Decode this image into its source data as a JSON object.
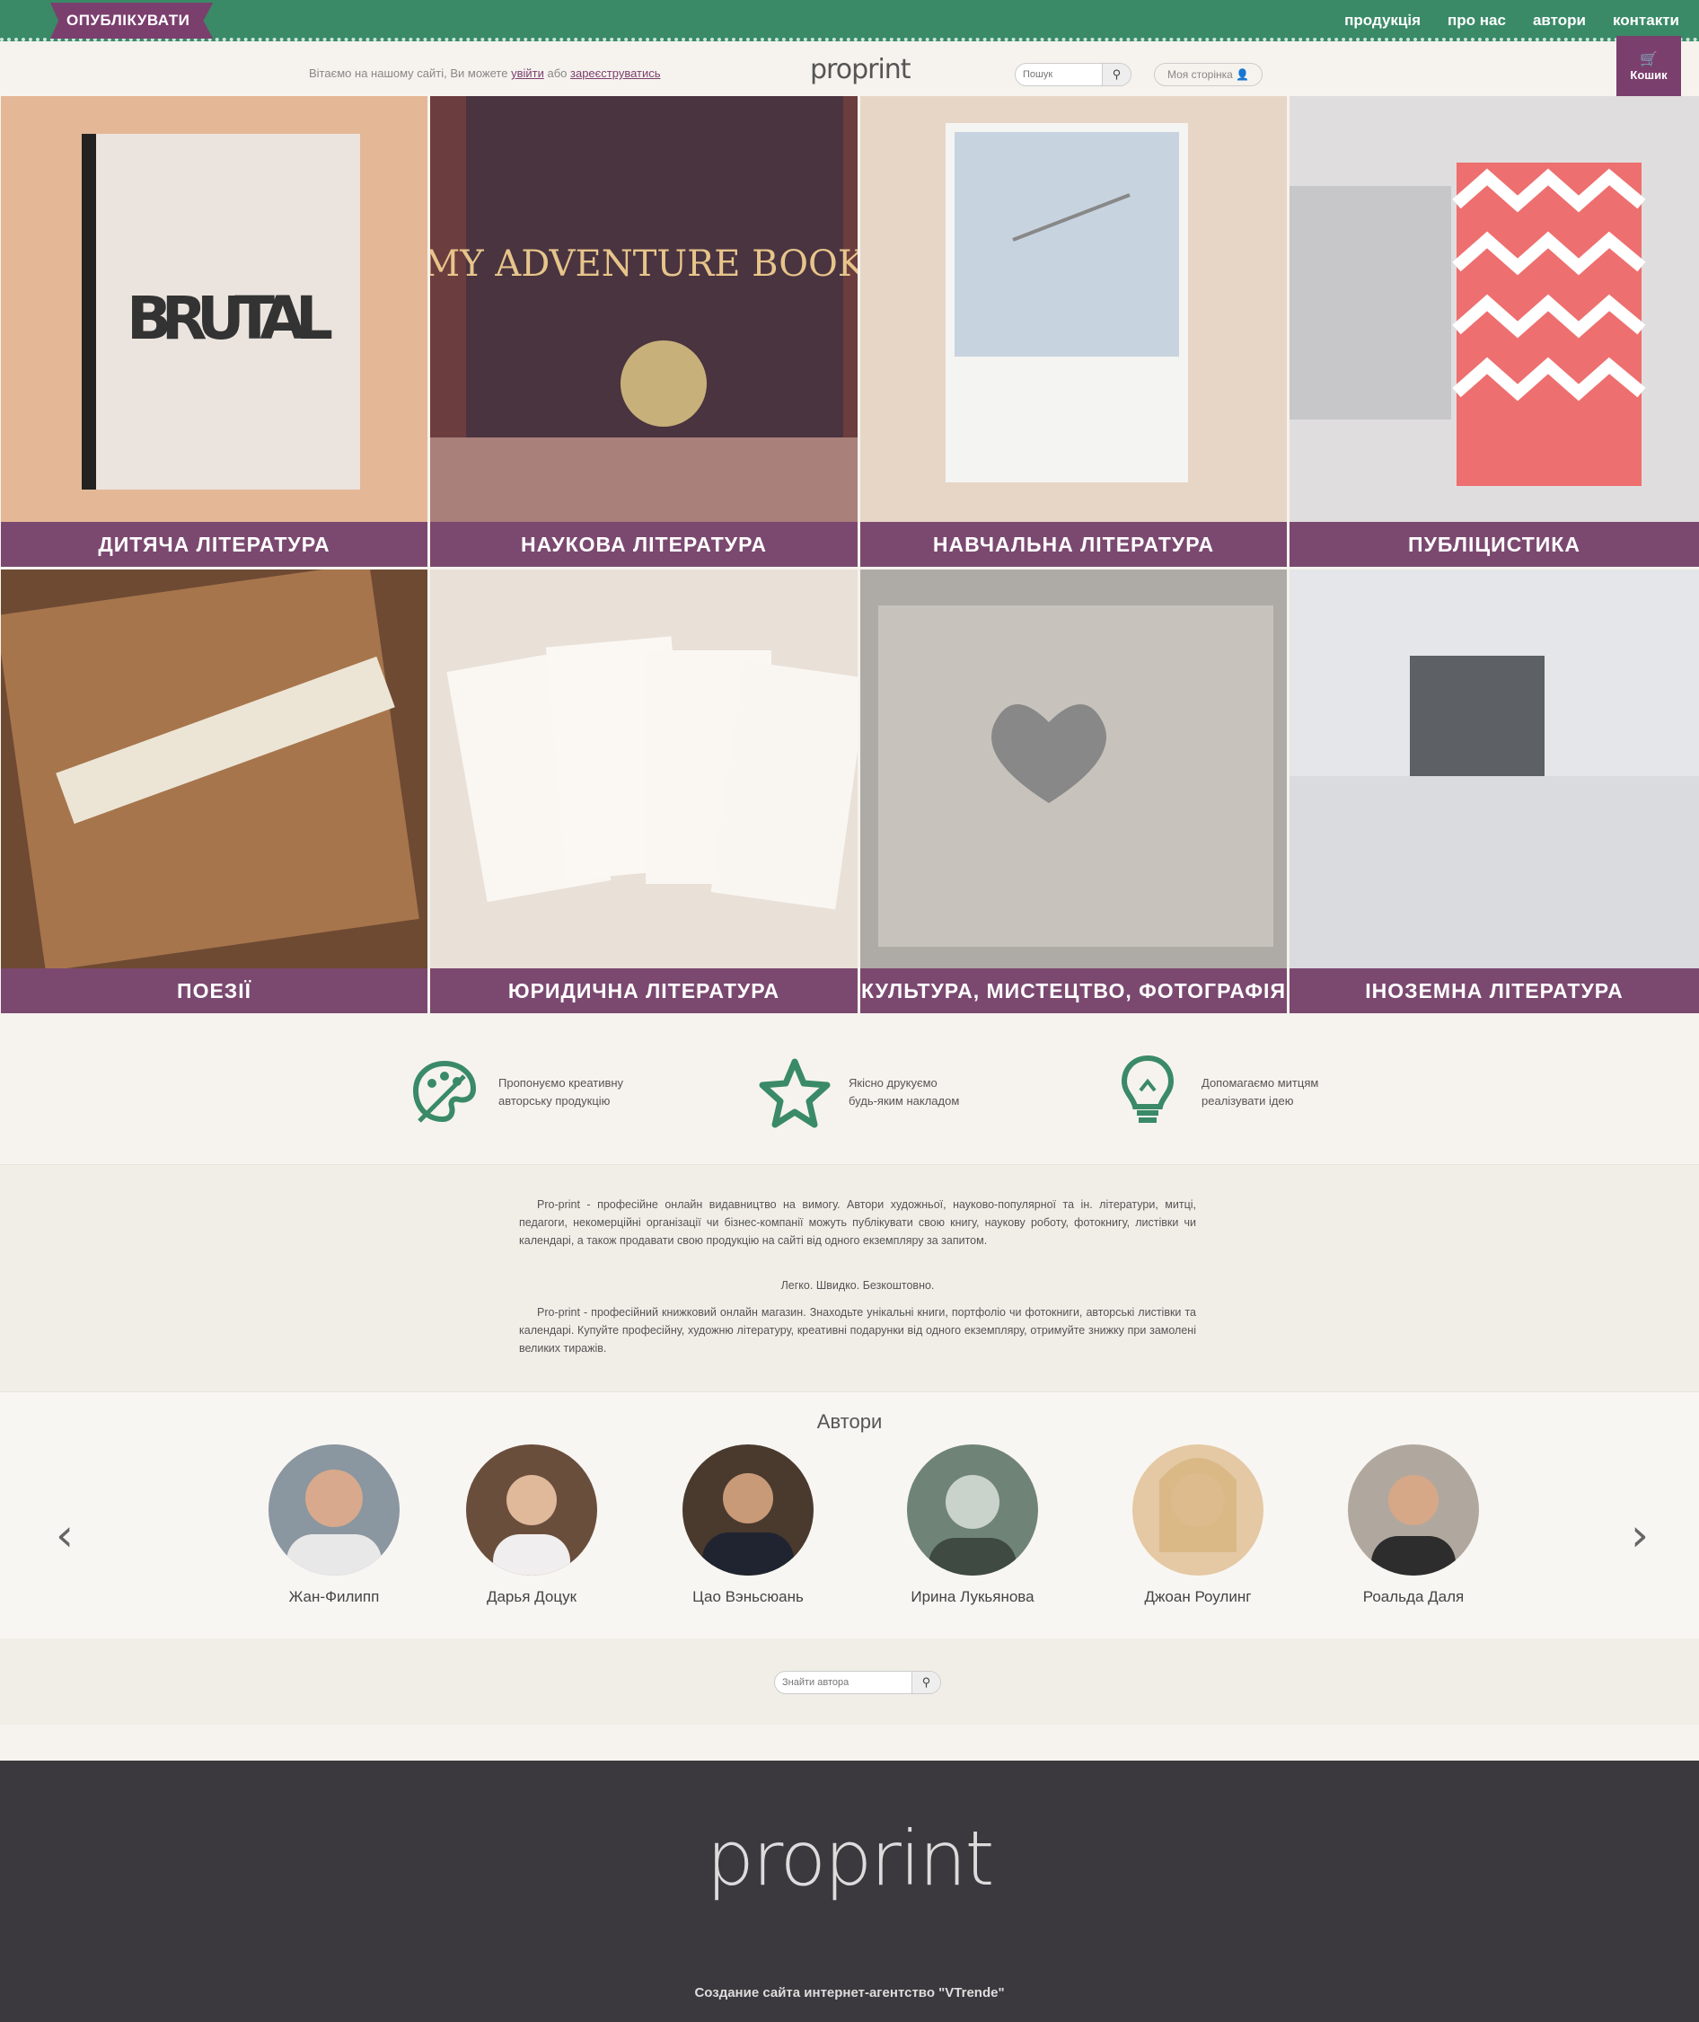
{
  "topbar": {
    "publish_label": "ОПУБЛІКУВАТИ",
    "nav": [
      "продукція",
      "про нас",
      "автори",
      "контакти"
    ],
    "cart_label": "Кошик"
  },
  "header": {
    "welcome_prefix": "Вітаємо на нашому сайті, Ви можете",
    "login": "увійти",
    "or": "або",
    "register": "зареєструватись",
    "logo": "proprint",
    "search_placeholder": "Пошук",
    "my_page": "Моя сторінка"
  },
  "categories": [
    "ДИТЯЧА ЛІТЕРАТУРА",
    "НАУКОВА ЛІТЕРАТУРА",
    "НАВЧАЛЬНА ЛІТЕРАТУРА",
    "ПУБЛІЦИСТИКА",
    "ПОЕЗІЇ",
    "ЮРИДИЧНА ЛІТЕРАТУРА",
    "КУЛЬТУРА, МИСТЕЦТВО, ФОТОГРАФІЯ",
    "ІНОЗЕМНА ЛІТЕРАТУРА"
  ],
  "image_texts": {
    "brutal": "BRUTAL",
    "adventure": "MY ADVENTURE BOOK"
  },
  "features": [
    {
      "line1": "Пропонуємо креативну",
      "line2": "авторську продукцію",
      "icon": "palette-icon"
    },
    {
      "line1": "Якісно друкуємо",
      "line2": "будь-яким накладом",
      "icon": "star-icon"
    },
    {
      "line1": "Допомагаємо митцям",
      "line2": "реалізувати ідею",
      "icon": "lightbulb-icon"
    }
  ],
  "about": {
    "p1": "Pro-print - професійне онлайн видавництво на вимогу. Автори художньої, науково-популярної та ін. літератури, митці, педагоги, некомерційні організації чи бізнес-компанії можуть публікувати свою книгу, наукову роботу, фотокнигу, листівки чи календарі, а також продавати свою продукцію на сайті від одного екземпляру за запитом.",
    "slogan": "Легко. Швидко. Безкоштовно.",
    "p2": "Pro-print - професійний книжковий онлайн магазин. Знаходьте унікальні книги, портфоліо чи фотокниги, авторські листівки та календарі. Купуйте професійну, художню літературу, креативні подарунки від одного екземпляру, отримуйте знижку при замолені великих тиражів."
  },
  "authors": {
    "title": "Автори",
    "list": [
      "Жан-Филипп",
      "Дарья Доцук",
      "Цао Вэньсюань",
      "Ирина Лукьянова",
      "Джоан Роулинг",
      "Роальда Даля"
    ],
    "search_placeholder": "Знайти автора"
  },
  "footer": {
    "logo": "proprint",
    "credit": "Создание сайта интернет-агентство \"VTrende\""
  },
  "colors": {
    "green": "#3a8a68",
    "purple": "#7b4970",
    "footer": "#3b393d"
  }
}
